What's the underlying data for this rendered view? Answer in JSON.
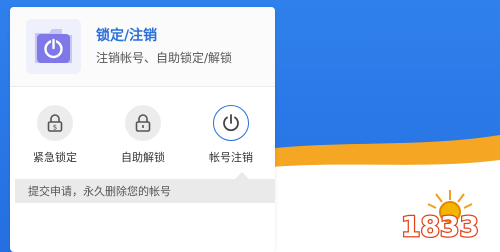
{
  "header": {
    "title": "锁定/注销",
    "subtitle": "注销帐号、自助锁定/解锁"
  },
  "actions": [
    {
      "label": "紧急锁定",
      "icon": "lock-dollar-icon",
      "selected": false
    },
    {
      "label": "自助解锁",
      "icon": "lock-icon",
      "selected": false
    },
    {
      "label": "帐号注销",
      "icon": "power-icon",
      "selected": true
    }
  ],
  "tooltip": {
    "text": "提交申请，永久删除您的帐号"
  },
  "watermark": {
    "text": "1833"
  },
  "colors": {
    "accent": "#2a6fd8",
    "background_blue": "#2f7ae6",
    "wave_orange": "#f5a623"
  }
}
